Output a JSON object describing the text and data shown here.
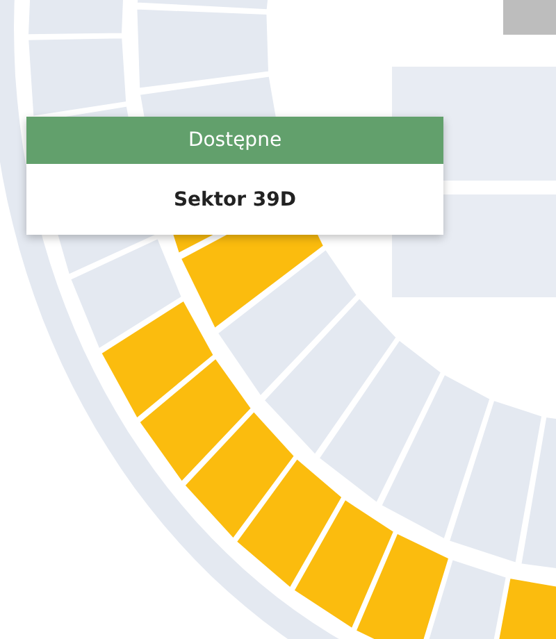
{
  "tooltip": {
    "status": "Dostępne",
    "sector": "Sektor 39D"
  },
  "outer_sectors": [
    {
      "available": false
    },
    {
      "available": false
    },
    {
      "available": false
    },
    {
      "available": false
    },
    {
      "available": false
    },
    {
      "available": true
    },
    {
      "available": true
    },
    {
      "available": true
    },
    {
      "available": true
    },
    {
      "available": true
    },
    {
      "available": true
    },
    {
      "available": false
    },
    {
      "available": true
    }
  ],
  "inner_sectors": [
    {
      "available": false
    },
    {
      "available": false
    },
    {
      "available": false
    },
    {
      "available": true
    },
    {
      "available": true
    },
    {
      "available": false
    },
    {
      "available": false
    },
    {
      "available": false
    },
    {
      "available": false
    },
    {
      "available": false
    },
    {
      "available": false
    }
  ]
}
